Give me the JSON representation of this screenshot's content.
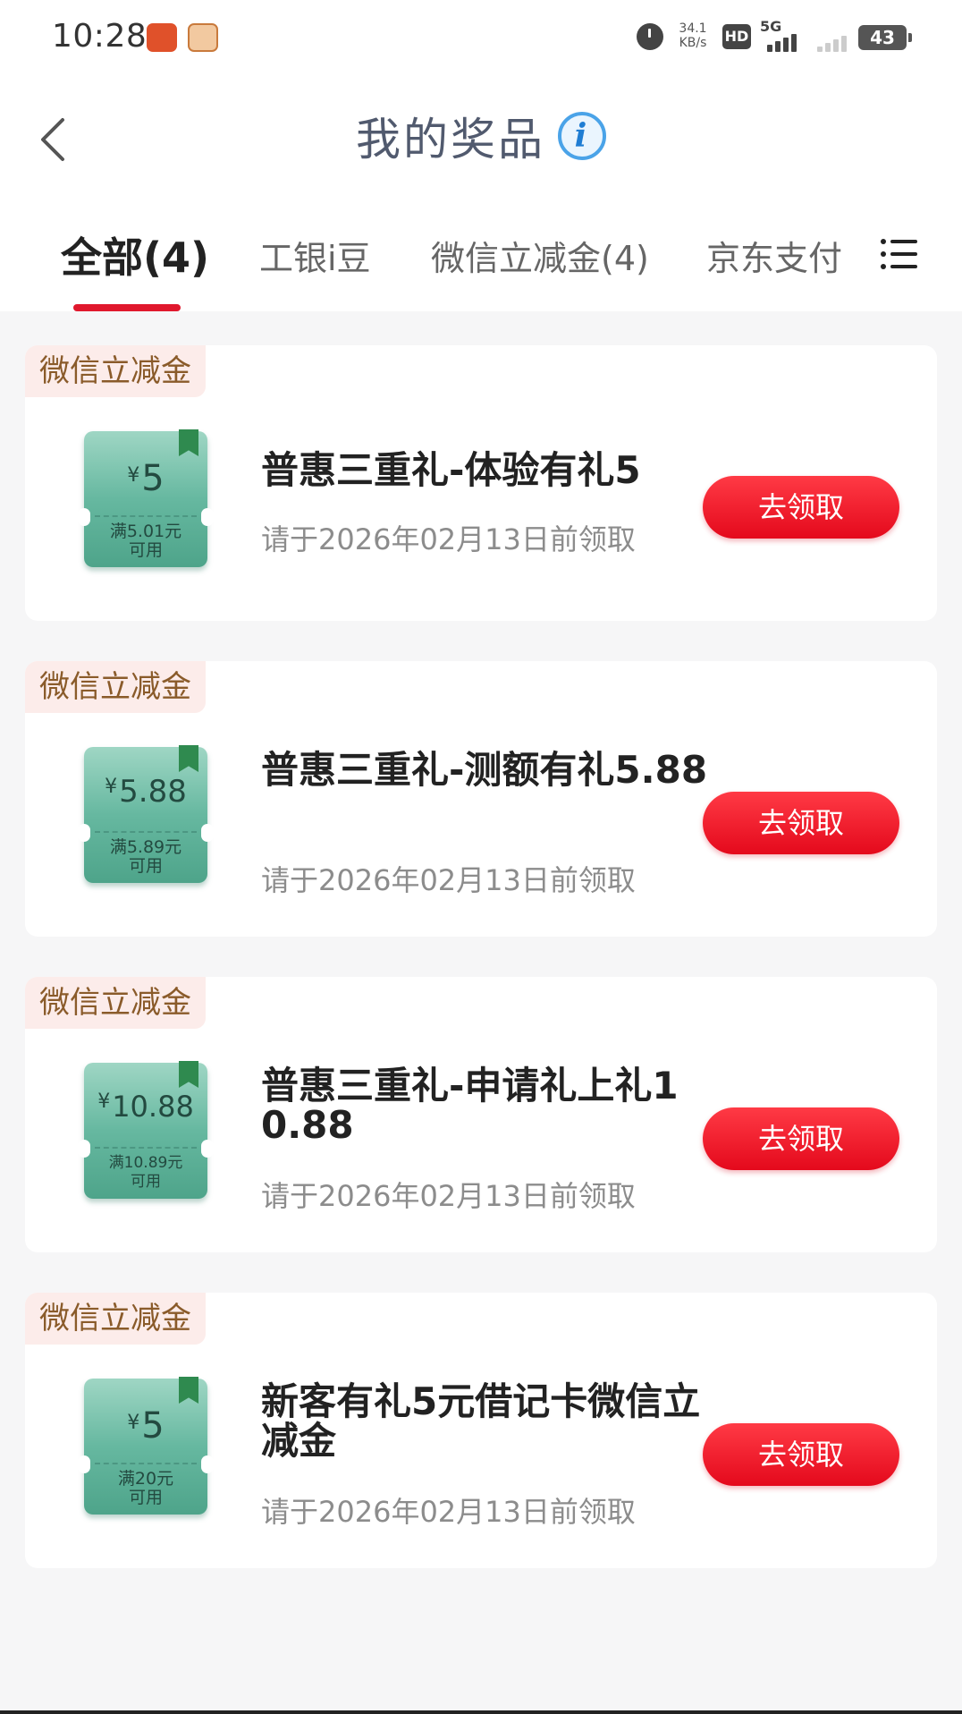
{
  "status_bar": {
    "time": "10:28",
    "net_speed_value": "34.1",
    "net_speed_unit": "KB/s",
    "hd_label": "HD",
    "network_label": "5G",
    "battery": "43",
    "icons": [
      "alarm-icon",
      "hd-icon",
      "signal-5g-icon",
      "signal-icon",
      "battery-icon"
    ]
  },
  "header": {
    "title": "我的奖品",
    "info_glyph": "i"
  },
  "tabs": [
    {
      "label": "全部(4)",
      "active": true
    },
    {
      "label": "工银i豆",
      "active": false
    },
    {
      "label": "微信立减金(4)",
      "active": false
    },
    {
      "label": "京东支付",
      "active": false
    }
  ],
  "accent_color": "#e0182d",
  "cards": [
    {
      "tag": "微信立减金",
      "coupon": {
        "currency": "¥",
        "amount": "5",
        "condition_line1": "满5.01元",
        "condition_line2": "可用"
      },
      "title": "普惠三重礼-体验有礼5",
      "expiry": "请于2026年02月13日前领取",
      "button": "去领取"
    },
    {
      "tag": "微信立减金",
      "coupon": {
        "currency": "¥",
        "amount": "5.88",
        "condition_line1": "满5.89元",
        "condition_line2": "可用"
      },
      "title": "普惠三重礼-测额有礼5.88",
      "expiry": "请于2026年02月13日前领取",
      "button": "去领取"
    },
    {
      "tag": "微信立减金",
      "coupon": {
        "currency": "¥",
        "amount": "10.88",
        "condition_line1": "满10.89元",
        "condition_line2": "可用"
      },
      "title": "普惠三重礼-申请礼上礼10.88",
      "expiry": "请于2026年02月13日前领取",
      "button": "去领取"
    },
    {
      "tag": "微信立减金",
      "coupon": {
        "currency": "¥",
        "amount": "5",
        "condition_line1": "满20元",
        "condition_line2": "可用"
      },
      "title": "新客有礼5元借记卡微信立减金",
      "expiry": "请于2026年02月13日前领取",
      "button": "去领取"
    }
  ]
}
